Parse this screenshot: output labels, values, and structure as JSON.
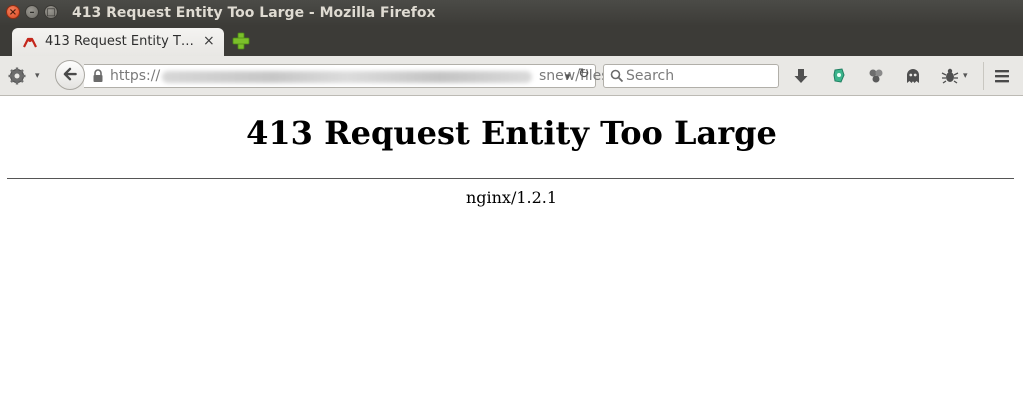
{
  "window": {
    "title": "413 Request Entity Too Large - Mozilla Firefox",
    "close_glyph": "×",
    "min_glyph": "–",
    "max_glyph": "□"
  },
  "tab": {
    "label": "413 Request Entity T…",
    "close_glyph": "×"
  },
  "toolbar": {
    "url_scheme": "https://",
    "url_visible_end": "snew/files",
    "url_dropdown_glyph": "▾",
    "reload_glyph": "↻",
    "search_placeholder": "Search",
    "dropdown_glyph": "▾"
  },
  "page": {
    "heading": "413 Request Entity Too Large",
    "server": "nginx/1.2.1"
  },
  "colors": {
    "titlebar": "#3c3b37",
    "tab_active": "#f0efed",
    "toolbar": "#e9e8e5",
    "close_button": "#e8562a",
    "newtab_plus": "#7bbf2a"
  },
  "icons": {
    "favicon": "error-favicon",
    "gear": "gear-icon",
    "back": "back-arrow-icon",
    "lock": "lock-icon",
    "download": "download-icon",
    "addon1": "addon-green-icon",
    "addon2": "addon-grey-icon",
    "ghostery": "ghost-icon",
    "addon3": "bug-icon",
    "menu": "hamburger-menu-icon"
  }
}
